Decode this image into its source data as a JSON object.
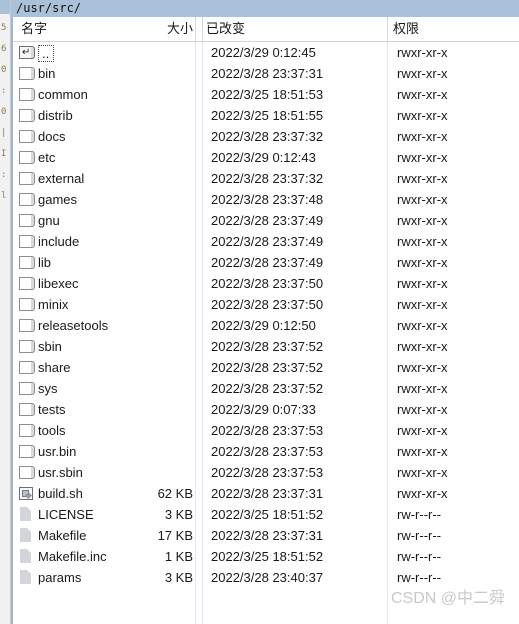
{
  "window": {
    "path_bar": "/usr/src/"
  },
  "columns": {
    "name": "名字",
    "size": "大小",
    "modified": "已改变",
    "permissions": "权限"
  },
  "icons": {
    "updir": "parent-directory-folder-icon",
    "folder": "folder-icon",
    "file": "file-icon",
    "script": "script-file-icon"
  },
  "colors": {
    "path_bar_background": "#a9c2da",
    "pane_accent": "#9fb8d0",
    "text": "#1a1a1a",
    "watermark": "#c9c9c9",
    "column_separator": "#e3e9f0"
  },
  "watermark": "CSDN @中二舜",
  "rows": [
    {
      "icon": "updir",
      "name": "..",
      "size": "",
      "modified": "2022/3/29 0:12:45",
      "permissions": "rwxr-xr-x",
      "selected": true
    },
    {
      "icon": "folder",
      "name": "bin",
      "size": "",
      "modified": "2022/3/28 23:37:31",
      "permissions": "rwxr-xr-x",
      "selected": false
    },
    {
      "icon": "folder",
      "name": "common",
      "size": "",
      "modified": "2022/3/25 18:51:53",
      "permissions": "rwxr-xr-x",
      "selected": false
    },
    {
      "icon": "folder",
      "name": "distrib",
      "size": "",
      "modified": "2022/3/25 18:51:55",
      "permissions": "rwxr-xr-x",
      "selected": false
    },
    {
      "icon": "folder",
      "name": "docs",
      "size": "",
      "modified": "2022/3/28 23:37:32",
      "permissions": "rwxr-xr-x",
      "selected": false
    },
    {
      "icon": "folder",
      "name": "etc",
      "size": "",
      "modified": "2022/3/29 0:12:43",
      "permissions": "rwxr-xr-x",
      "selected": false
    },
    {
      "icon": "folder",
      "name": "external",
      "size": "",
      "modified": "2022/3/28 23:37:32",
      "permissions": "rwxr-xr-x",
      "selected": false
    },
    {
      "icon": "folder",
      "name": "games",
      "size": "",
      "modified": "2022/3/28 23:37:48",
      "permissions": "rwxr-xr-x",
      "selected": false
    },
    {
      "icon": "folder",
      "name": "gnu",
      "size": "",
      "modified": "2022/3/28 23:37:49",
      "permissions": "rwxr-xr-x",
      "selected": false
    },
    {
      "icon": "folder",
      "name": "include",
      "size": "",
      "modified": "2022/3/28 23:37:49",
      "permissions": "rwxr-xr-x",
      "selected": false
    },
    {
      "icon": "folder",
      "name": "lib",
      "size": "",
      "modified": "2022/3/28 23:37:49",
      "permissions": "rwxr-xr-x",
      "selected": false
    },
    {
      "icon": "folder",
      "name": "libexec",
      "size": "",
      "modified": "2022/3/28 23:37:50",
      "permissions": "rwxr-xr-x",
      "selected": false
    },
    {
      "icon": "folder",
      "name": "minix",
      "size": "",
      "modified": "2022/3/28 23:37:50",
      "permissions": "rwxr-xr-x",
      "selected": false
    },
    {
      "icon": "folder",
      "name": "releasetools",
      "size": "",
      "modified": "2022/3/29 0:12:50",
      "permissions": "rwxr-xr-x",
      "selected": false
    },
    {
      "icon": "folder",
      "name": "sbin",
      "size": "",
      "modified": "2022/3/28 23:37:52",
      "permissions": "rwxr-xr-x",
      "selected": false
    },
    {
      "icon": "folder",
      "name": "share",
      "size": "",
      "modified": "2022/3/28 23:37:52",
      "permissions": "rwxr-xr-x",
      "selected": false
    },
    {
      "icon": "folder",
      "name": "sys",
      "size": "",
      "modified": "2022/3/28 23:37:52",
      "permissions": "rwxr-xr-x",
      "selected": false
    },
    {
      "icon": "folder",
      "name": "tests",
      "size": "",
      "modified": "2022/3/29 0:07:33",
      "permissions": "rwxr-xr-x",
      "selected": false
    },
    {
      "icon": "folder",
      "name": "tools",
      "size": "",
      "modified": "2022/3/28 23:37:53",
      "permissions": "rwxr-xr-x",
      "selected": false
    },
    {
      "icon": "folder",
      "name": "usr.bin",
      "size": "",
      "modified": "2022/3/28 23:37:53",
      "permissions": "rwxr-xr-x",
      "selected": false
    },
    {
      "icon": "folder",
      "name": "usr.sbin",
      "size": "",
      "modified": "2022/3/28 23:37:53",
      "permissions": "rwxr-xr-x",
      "selected": false
    },
    {
      "icon": "script",
      "name": "build.sh",
      "size": "62 KB",
      "modified": "2022/3/28 23:37:31",
      "permissions": "rwxr-xr-x",
      "selected": false
    },
    {
      "icon": "file",
      "name": "LICENSE",
      "size": "3 KB",
      "modified": "2022/3/25 18:51:52",
      "permissions": "rw-r--r--",
      "selected": false
    },
    {
      "icon": "file",
      "name": "Makefile",
      "size": "17 KB",
      "modified": "2022/3/28 23:37:31",
      "permissions": "rw-r--r--",
      "selected": false
    },
    {
      "icon": "file",
      "name": "Makefile.inc",
      "size": "1 KB",
      "modified": "2022/3/25 18:51:52",
      "permissions": "rw-r--r--",
      "selected": false
    },
    {
      "icon": "file",
      "name": "params",
      "size": "3 KB",
      "modified": "2022/3/28 23:40:37",
      "permissions": "rw-r--r--",
      "selected": false
    }
  ]
}
